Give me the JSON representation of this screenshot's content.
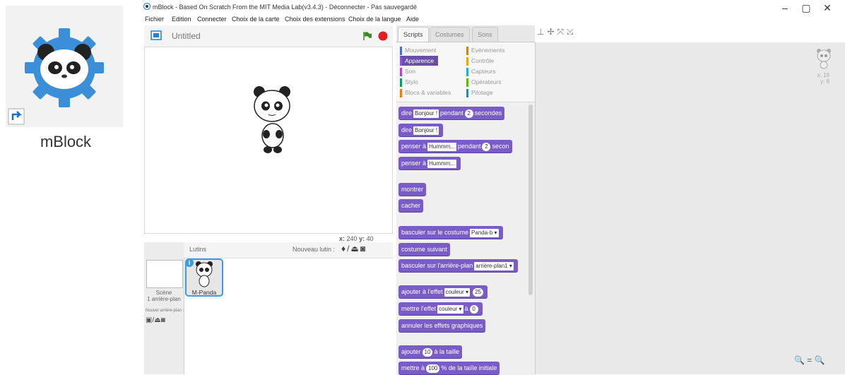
{
  "desktop": {
    "shortcut_label": "mBlock"
  },
  "window": {
    "title": "mBlock - Based On Scratch From the MIT Media Lab(v3.4.3) - Déconnecter - Pas sauvegardé",
    "min_icon": "minimize-icon",
    "max_icon": "maximize-icon",
    "close_icon": "close-icon"
  },
  "menu": [
    "Fichier",
    "Edition",
    "Connecter",
    "Choix de la carte",
    "Choix des extensions",
    "Choix de la langue",
    "Aide"
  ],
  "stage": {
    "project_title": "Untitled",
    "coord_x_label": "x:",
    "coord_x": "240",
    "coord_y_label": "y:",
    "coord_y": "40"
  },
  "sprites": {
    "header_label": "Lutins",
    "new_sprite_label": "Nouveau lutin :",
    "scene_label": "Scène",
    "scene_backdrops": "1 arrière-plan",
    "new_backdrop_label": "Nouvel arrière-plan :",
    "sprite_name": "M-Panda"
  },
  "tabs": [
    "Scripts",
    "Costumes",
    "Sons"
  ],
  "categories": [
    {
      "label": "Mouvement",
      "color": "#4a6cd4"
    },
    {
      "label": "Evènements",
      "color": "#c88330"
    },
    {
      "label": "Apparence",
      "color": "#8a55d7"
    },
    {
      "label": "Contrôle",
      "color": "#e1a91a"
    },
    {
      "label": "Son",
      "color": "#bb42c3"
    },
    {
      "label": "Capteurs",
      "color": "#2ca5e2"
    },
    {
      "label": "Stylo",
      "color": "#0e9a6c"
    },
    {
      "label": "Opérateurs",
      "color": "#5cb712"
    },
    {
      "label": "Blocs & variables",
      "color": "#ee7d16"
    },
    {
      "label": "Pilotage",
      "color": "#2e8e8e"
    }
  ],
  "blocks": {
    "b1": {
      "text_a": "dire",
      "input": "Bonjour !",
      "text_b": "pendant",
      "num": "2",
      "text_c": "secondes"
    },
    "b2": {
      "text_a": "dire",
      "input": "Bonjour !"
    },
    "b3": {
      "text_a": "penser à",
      "input": "Hummm...",
      "text_b": "pendant",
      "num": "2",
      "text_c": "secon"
    },
    "b4": {
      "text_a": "penser à",
      "input": "Hummm..."
    },
    "b5": {
      "text_a": "montrer"
    },
    "b6": {
      "text_a": "cacher"
    },
    "b7": {
      "text_a": "basculer sur le costume",
      "input": "Panda-b ▾"
    },
    "b8": {
      "text_a": "costume suivant"
    },
    "b9": {
      "text_a": "basculer sur l'arrière-plan",
      "input": "arrière-plan1 ▾"
    },
    "b10": {
      "text_a": "ajouter à l'effet",
      "input": "couleur ▾",
      "num": "25"
    },
    "b11": {
      "text_a": "mettre l'effet",
      "input": "couleur ▾",
      "text_b": "à",
      "num": "0"
    },
    "b12": {
      "text_a": "annuler les effets graphiques"
    },
    "b13": {
      "text_a": "ajouter",
      "num": "10",
      "text_b": "à la taille"
    },
    "b14": {
      "text_a": "mettre à",
      "num": "100",
      "text_b": "% de la taille initiale"
    }
  },
  "scripts_area": {
    "sprite_x_label": "x:",
    "sprite_x": "19",
    "sprite_y_label": "y:",
    "sprite_y": "8",
    "zoom_out": "zoom-out-icon",
    "zoom_reset": "zoom-reset-icon",
    "zoom_in": "zoom-in-icon"
  },
  "colors": {
    "block_looks": "#7a5cc8",
    "active_category": "#6a4fa8",
    "sprite_selected": "#3a9be0",
    "stop": "#e02020",
    "flag": "#3a8a2a"
  }
}
